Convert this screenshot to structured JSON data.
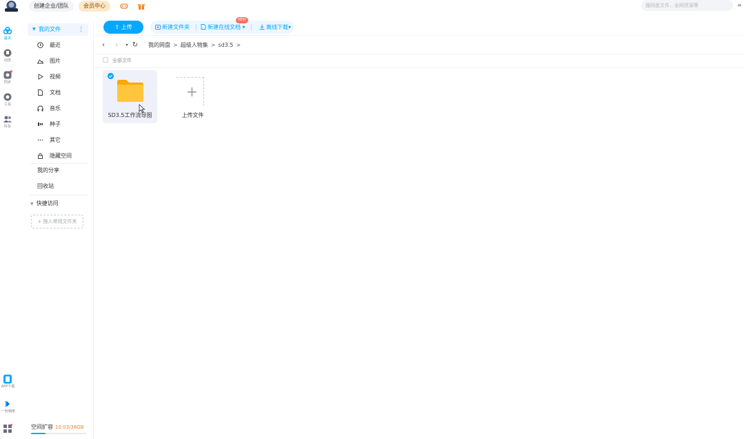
{
  "topbar": {
    "team_label": "创建企业/团队",
    "vip_label": "会员中心",
    "search_placeholder": "搜网盘文件、全网资源等"
  },
  "rail": {
    "items": [
      {
        "label": "首页",
        "icon": "cloud-icon"
      },
      {
        "label": "动态",
        "icon": "activity-icon"
      },
      {
        "label": "同步",
        "icon": "sync-icon"
      },
      {
        "label": "工具",
        "icon": "tools-icon"
      },
      {
        "label": "好友",
        "icon": "friends-icon"
      },
      {
        "label": "APP下载",
        "icon": "phone-icon"
      },
      {
        "label": "一刻相册",
        "icon": "album-icon"
      },
      {
        "label": "",
        "icon": "apps-icon"
      }
    ]
  },
  "sidebar": {
    "header": "我的文件",
    "categories": [
      {
        "label": "最近",
        "icon": "clock-icon"
      },
      {
        "label": "图片",
        "icon": "image-icon"
      },
      {
        "label": "视频",
        "icon": "video-icon"
      },
      {
        "label": "文档",
        "icon": "document-icon"
      },
      {
        "label": "音乐",
        "icon": "music-icon"
      },
      {
        "label": "种子",
        "icon": "torrent-icon"
      },
      {
        "label": "其它",
        "icon": "more-icon"
      },
      {
        "label": "隐藏空间",
        "icon": "lock-icon"
      }
    ],
    "shares": "我的分享",
    "recycle": "回收站",
    "quick_access": "快捷访问",
    "quick_add": "+ 拖入常用文件夹",
    "storage_label": "空间扩容",
    "storage_value": "10.03/38GB",
    "storage_fraction": 0.26
  },
  "toolbar": {
    "upload": "上传",
    "new_folder": "新建文件夹",
    "new_online_doc": "新建在线文档",
    "new_badge": "NEW",
    "offline_download": "离线下载"
  },
  "breadcrumb": [
    "我的网盘",
    "超级人物集",
    "sd3.5"
  ],
  "list": {
    "select_all": "全部文件",
    "files": [
      {
        "name": "SD3.5工作流导图",
        "type": "folder",
        "selected": true
      }
    ],
    "upload_tile": "上传文件"
  },
  "colors": {
    "accent": "#06a7ff",
    "folder": "#ffc53d",
    "storage_highlight": "#f58220"
  }
}
